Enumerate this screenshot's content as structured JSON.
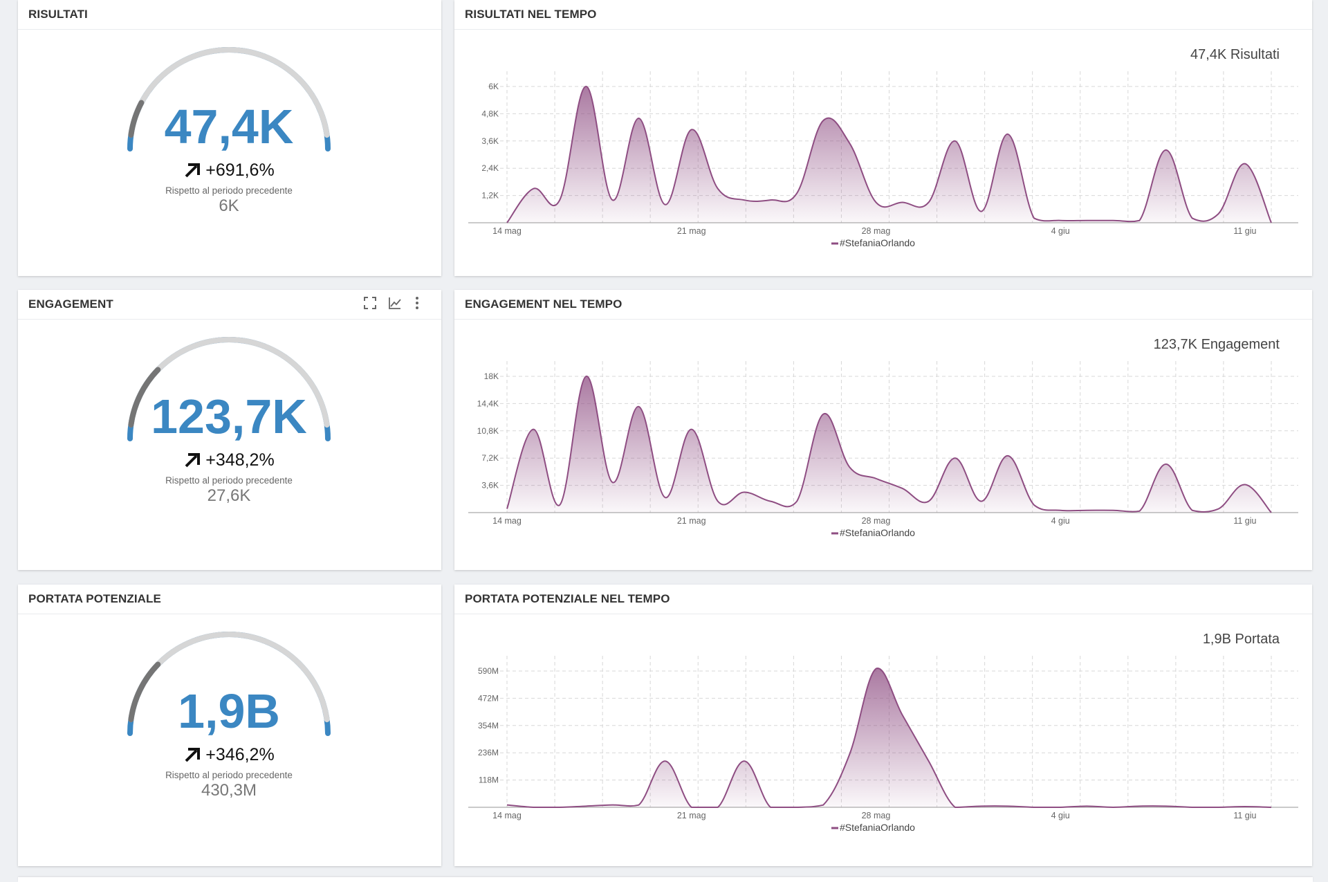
{
  "colors": {
    "gauge_blue": "#3b87c2",
    "gauge_dark": "#757575",
    "gauge_light": "#d6d6d6",
    "series": "#8e4d82",
    "text_dark": "#333333",
    "grid": "#d7d7d7"
  },
  "kpis": [
    {
      "title": "RISULTATI",
      "value": "47,4K",
      "change": "+691,6%",
      "compare_label": "Rispetto al periodo precedente",
      "previous": "6K",
      "blue_fraction": 1.0,
      "dark_fraction": 0.12,
      "icon": "arrow-up-right-icon"
    },
    {
      "title": "ENGAGEMENT",
      "value": "123,7K",
      "change": "+348,2%",
      "compare_label": "Rispetto al periodo precedente",
      "previous": "27,6K",
      "blue_fraction": 1.0,
      "dark_fraction": 0.22,
      "icon": "arrow-up-right-icon",
      "tools": [
        "expand-icon",
        "line-chart-icon",
        "more-vertical-icon"
      ]
    },
    {
      "title": "PORTATA POTENZIALE",
      "value": "1,9B",
      "change": "+346,2%",
      "compare_label": "Rispetto al periodo precedente",
      "previous": "430,3M",
      "blue_fraction": 1.0,
      "dark_fraction": 0.22,
      "icon": "arrow-up-right-icon"
    }
  ],
  "chart_data": [
    {
      "type": "area",
      "title": "RISULTATI NEL TEMPO",
      "total_label": "47,4K Risultati",
      "legend_position": "bottom-center",
      "grid": true,
      "x": [
        "14 mag",
        "15 mag",
        "16 mag",
        "17 mag",
        "18 mag",
        "19 mag",
        "20 mag",
        "21 mag",
        "22 mag",
        "23 mag",
        "24 mag",
        "25 mag",
        "26 mag",
        "27 mag",
        "28 mag",
        "29 mag",
        "30 mag",
        "31 mag",
        "1 giu",
        "2 giu",
        "3 giu",
        "4 giu",
        "5 giu",
        "6 giu",
        "7 giu",
        "8 giu",
        "9 giu",
        "10 giu",
        "11 giu",
        "12 giu"
      ],
      "x_tick_labels": [
        "14 mag",
        "21 mag",
        "28 mag",
        "4 giu",
        "11 giu"
      ],
      "y_ticks": [
        "1,2K",
        "2,4K",
        "3,6K",
        "4,8K",
        "6K"
      ],
      "ylim": [
        0,
        6000
      ],
      "series": [
        {
          "name": "#StefaniaOrlando",
          "values": [
            0,
            1500,
            1000,
            6000,
            1000,
            4600,
            800,
            4100,
            1500,
            1000,
            1000,
            1300,
            4500,
            3500,
            900,
            900,
            900,
            3600,
            500,
            3900,
            200,
            100,
            100,
            100,
            100,
            3200,
            200,
            400,
            2600,
            0
          ]
        }
      ]
    },
    {
      "type": "area",
      "title": "ENGAGEMENT NEL TEMPO",
      "total_label": "123,7K Engagement",
      "legend_position": "bottom-center",
      "grid": true,
      "x": [
        "14 mag",
        "15 mag",
        "16 mag",
        "17 mag",
        "18 mag",
        "19 mag",
        "20 mag",
        "21 mag",
        "22 mag",
        "23 mag",
        "24 mag",
        "25 mag",
        "26 mag",
        "27 mag",
        "28 mag",
        "29 mag",
        "30 mag",
        "31 mag",
        "1 giu",
        "2 giu",
        "3 giu",
        "4 giu",
        "5 giu",
        "6 giu",
        "7 giu",
        "8 giu",
        "9 giu",
        "10 giu",
        "11 giu",
        "12 giu"
      ],
      "x_tick_labels": [
        "14 mag",
        "21 mag",
        "28 mag",
        "4 giu",
        "11 giu"
      ],
      "y_ticks": [
        "3,6K",
        "7,2K",
        "10,8K",
        "14,4K",
        "18K"
      ],
      "ylim": [
        0,
        18000
      ],
      "series": [
        {
          "name": "#StefaniaOrlando",
          "values": [
            500,
            11000,
            1000,
            18000,
            4000,
            14000,
            2000,
            11000,
            1500,
            2700,
            1500,
            1500,
            13000,
            6000,
            4500,
            3200,
            1500,
            7200,
            1500,
            7500,
            1000,
            300,
            300,
            300,
            200,
            6400,
            300,
            500,
            3700,
            0
          ]
        }
      ]
    },
    {
      "type": "area",
      "title": "PORTATA POTENZIALE NEL TEMPO",
      "total_label": "1,9B Portata",
      "legend_position": "bottom-center",
      "grid": true,
      "x": [
        "14 mag",
        "15 mag",
        "16 mag",
        "17 mag",
        "18 mag",
        "19 mag",
        "20 mag",
        "21 mag",
        "22 mag",
        "23 mag",
        "24 mag",
        "25 mag",
        "26 mag",
        "27 mag",
        "28 mag",
        "29 mag",
        "30 mag",
        "31 mag",
        "1 giu",
        "2 giu",
        "3 giu",
        "4 giu",
        "5 giu",
        "6 giu",
        "7 giu",
        "8 giu",
        "9 giu",
        "10 giu",
        "11 giu",
        "12 giu"
      ],
      "x_tick_labels": [
        "14 mag",
        "21 mag",
        "28 mag",
        "4 giu",
        "11 giu"
      ],
      "y_ticks": [
        "118M",
        "236M",
        "354M",
        "472M",
        "590M"
      ],
      "ylim": [
        0,
        590000000
      ],
      "series": [
        {
          "name": "#StefaniaOrlando",
          "values": [
            10000000,
            0,
            0,
            5000000,
            10000000,
            10000000,
            200000000,
            0,
            0,
            200000000,
            0,
            0,
            10000000,
            230000000,
            600000000,
            400000000,
            200000000,
            0,
            5000000,
            5000000,
            0,
            0,
            5000000,
            0,
            5000000,
            5000000,
            0,
            0,
            3000000,
            0
          ]
        }
      ]
    }
  ]
}
